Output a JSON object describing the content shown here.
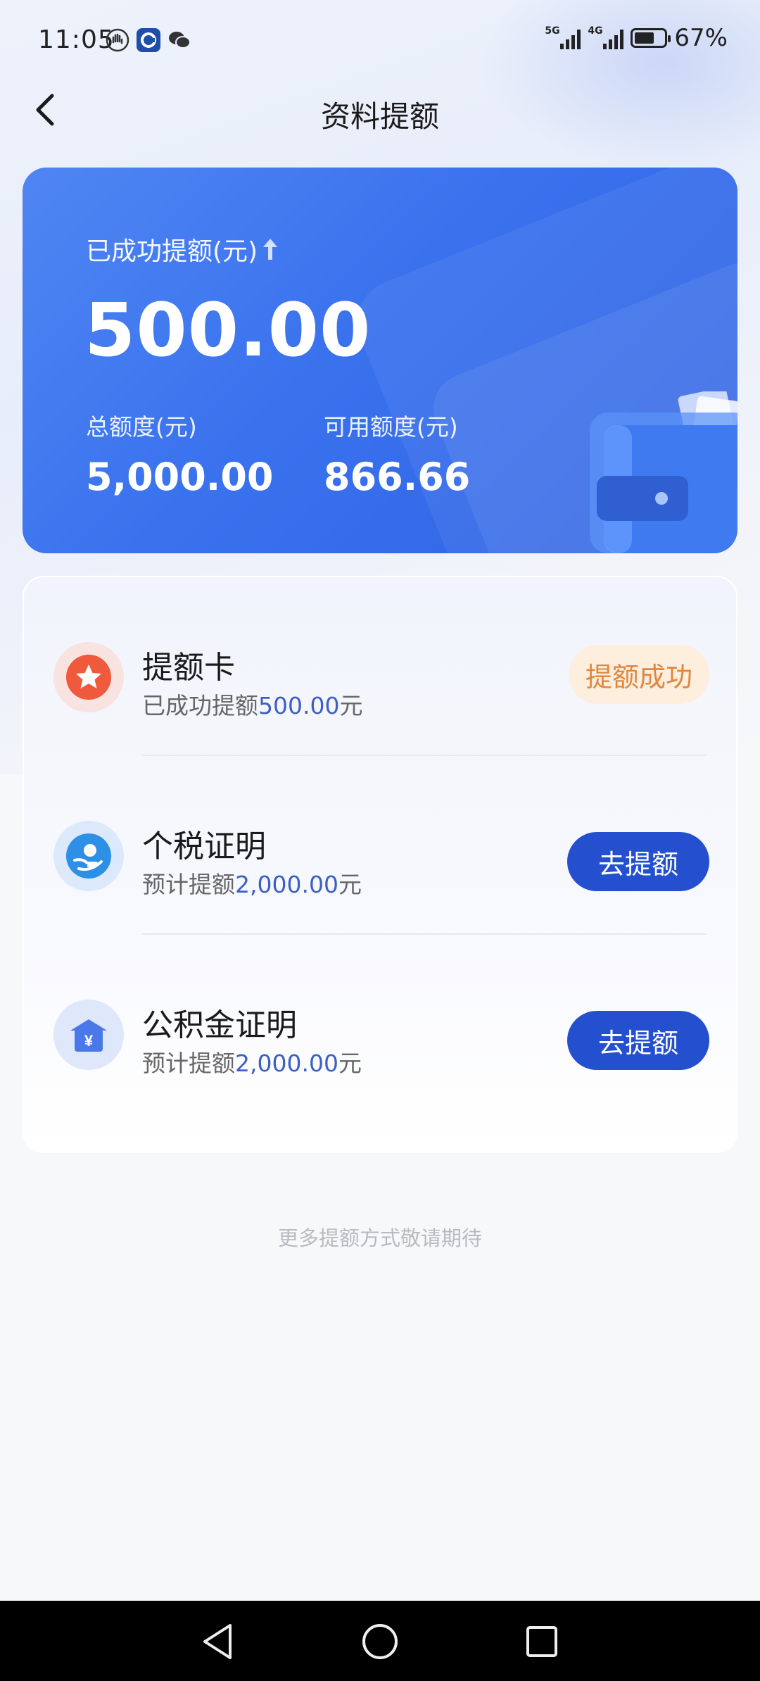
{
  "status_bar": {
    "time": "11:05",
    "signal_1_label": "5G",
    "signal_2_label": "4G",
    "battery_text": "67%",
    "battery_level": 0.67
  },
  "header": {
    "title": "资料提额"
  },
  "hero": {
    "label": "已成功提额(元)",
    "amount": "500.00",
    "total_label": "总额度(元)",
    "total_value": "5,000.00",
    "available_label": "可用额度(元)",
    "available_value": "866.66"
  },
  "items": [
    {
      "title": "提额卡",
      "desc_prefix": "已成功提额",
      "desc_amount": "500.00",
      "desc_suffix": "元",
      "action": "提额成功"
    },
    {
      "title": "个税证明",
      "desc_prefix": "预计提额",
      "desc_amount": "2,000.00",
      "desc_suffix": "元",
      "action": "去提额"
    },
    {
      "title": "公积金证明",
      "desc_prefix": "预计提额",
      "desc_amount": "2,000.00",
      "desc_suffix": "元",
      "action": "去提额"
    }
  ],
  "footer_note": "更多提额方式敬请期待",
  "colors": {
    "accent": "#2450cf",
    "hero_start": "#4f86f3",
    "hero_end": "#2f62e3",
    "success_bg": "#fdeede",
    "success_text": "#e0873e",
    "amount_highlight": "#3c5fc6"
  },
  "icons": {
    "back": "chevron-left-icon",
    "item_0": "star-badge-icon",
    "item_1": "hand-coin-icon",
    "item_2": "house-yuan-icon"
  }
}
